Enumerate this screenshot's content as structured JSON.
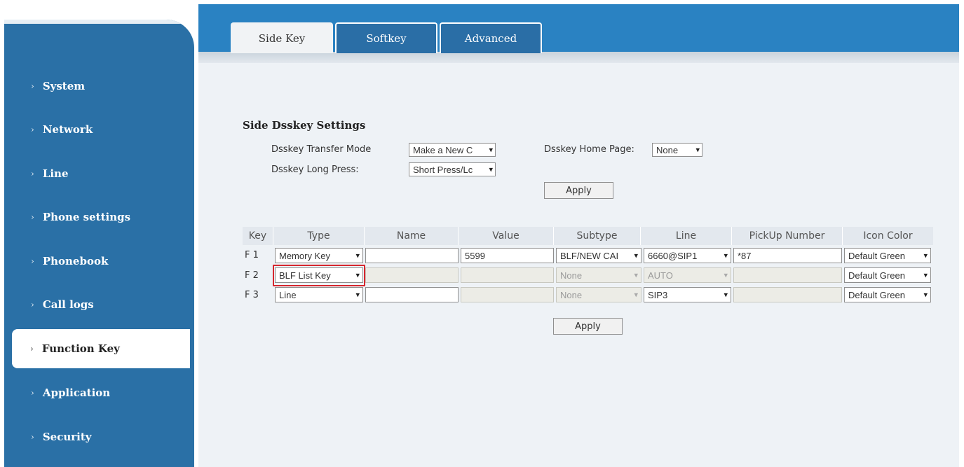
{
  "sidebar": {
    "items": [
      {
        "label": "System",
        "active": false
      },
      {
        "label": "Network",
        "active": false
      },
      {
        "label": "Line",
        "active": false
      },
      {
        "label": "Phone settings",
        "active": false
      },
      {
        "label": "Phonebook",
        "active": false
      },
      {
        "label": "Call logs",
        "active": false
      },
      {
        "label": "Function Key",
        "active": true
      },
      {
        "label": "Application",
        "active": false
      },
      {
        "label": "Security",
        "active": false
      }
    ]
  },
  "tabs": [
    {
      "label": "Side Key",
      "active": true
    },
    {
      "label": "Softkey",
      "active": false
    },
    {
      "label": "Advanced",
      "active": false
    }
  ],
  "settings": {
    "title": "Side Dsskey Settings",
    "transfer_mode_label": "Dsskey Transfer Mode",
    "transfer_mode_value": "Make a New C",
    "home_page_label": "Dsskey Home Page:",
    "home_page_value": "None",
    "long_press_label": "Dsskey Long Press:",
    "long_press_value": "Short Press/Lc",
    "apply_label": "Apply"
  },
  "table": {
    "headers": [
      "Key",
      "Type",
      "Name",
      "Value",
      "Subtype",
      "Line",
      "PickUp Number",
      "Icon Color"
    ],
    "rows": [
      {
        "key": "F 1",
        "type": "Memory Key",
        "name": "",
        "value": "5599",
        "subtype": "BLF/NEW CAI",
        "line": "6660@SIP1",
        "pickup": "*87",
        "icon_color": "Default Green",
        "disabled": false
      },
      {
        "key": "F 2",
        "type": "BLF List Key",
        "name": "",
        "value": "",
        "subtype": "None",
        "line": "AUTO",
        "pickup": "",
        "icon_color": "Default Green",
        "disabled": true
      },
      {
        "key": "F 3",
        "type": "Line",
        "name": "",
        "value": "",
        "subtype": "None",
        "line": "SIP3",
        "pickup": "",
        "icon_color": "Default Green",
        "disabled": "partial"
      }
    ],
    "apply_label": "Apply"
  },
  "icons": {
    "chevron_right": "›",
    "dropdown": "▾"
  },
  "colors": {
    "sidebar": "#2a70a6",
    "header": "#2a82c2",
    "highlight": "#d6262e"
  }
}
